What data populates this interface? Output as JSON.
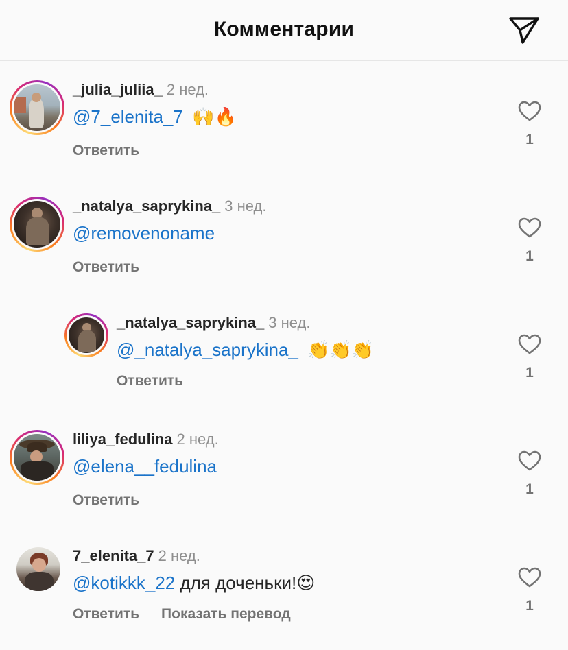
{
  "header": {
    "title": "Комментарии",
    "share_icon": "paper-plane-icon"
  },
  "colors": {
    "mention": "#1a73c9",
    "secondary_text": "#8e8e8e",
    "action_text": "#737373",
    "ring_gradient": [
      "#feda75",
      "#fa7e1e",
      "#d62976",
      "#962fbf"
    ]
  },
  "comments": [
    {
      "username": "_julia_juliia_",
      "time": "2 нед.",
      "mention": "@7_elenita_7",
      "text": "",
      "emoji": "🙌🔥",
      "reply_label": "Ответить",
      "like_count": "1",
      "has_story_ring": true
    },
    {
      "username": "_natalya_saprykina_",
      "time": "3 нед.",
      "mention": "@removenoname",
      "text": "",
      "emoji": "",
      "reply_label": "Ответить",
      "like_count": "1",
      "has_story_ring": true
    },
    {
      "username": "_natalya_saprykina_",
      "time": "3 нед.",
      "mention": "@_natalya_saprykina_",
      "text": "",
      "emoji": "👏👏👏",
      "reply_label": "Ответить",
      "like_count": "1",
      "has_story_ring": true,
      "is_reply": true
    },
    {
      "username": "liliya_fedulina",
      "time": "2 нед.",
      "mention": "@elena__fedulina",
      "text": "",
      "emoji": "",
      "reply_label": "Ответить",
      "like_count": "1",
      "has_story_ring": true
    },
    {
      "username": "7_elenita_7",
      "time": "2 нед.",
      "mention": "@kotikkk_22",
      "text": "для доченьки!",
      "emoji": "😍",
      "reply_label": "Ответить",
      "translate_label": "Показать перевод",
      "like_count": "1",
      "has_story_ring": false
    }
  ]
}
